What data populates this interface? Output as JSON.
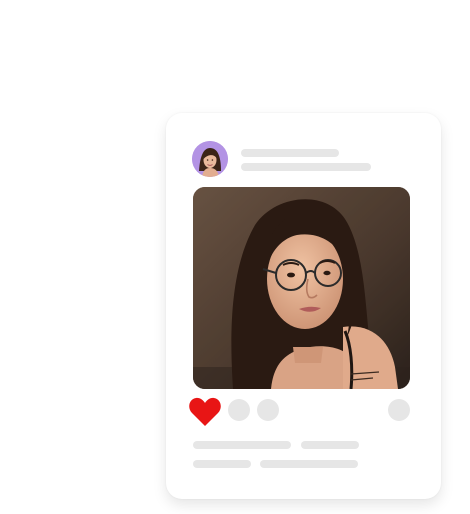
{
  "post": {
    "avatar_icon": "user-avatar-icon",
    "photo_icon": "portrait-photo",
    "like_icon": "heart-icon",
    "like_color": "#e81515",
    "accent_avatar": "#b393e4",
    "skeleton_color": "#e6e6e6"
  }
}
